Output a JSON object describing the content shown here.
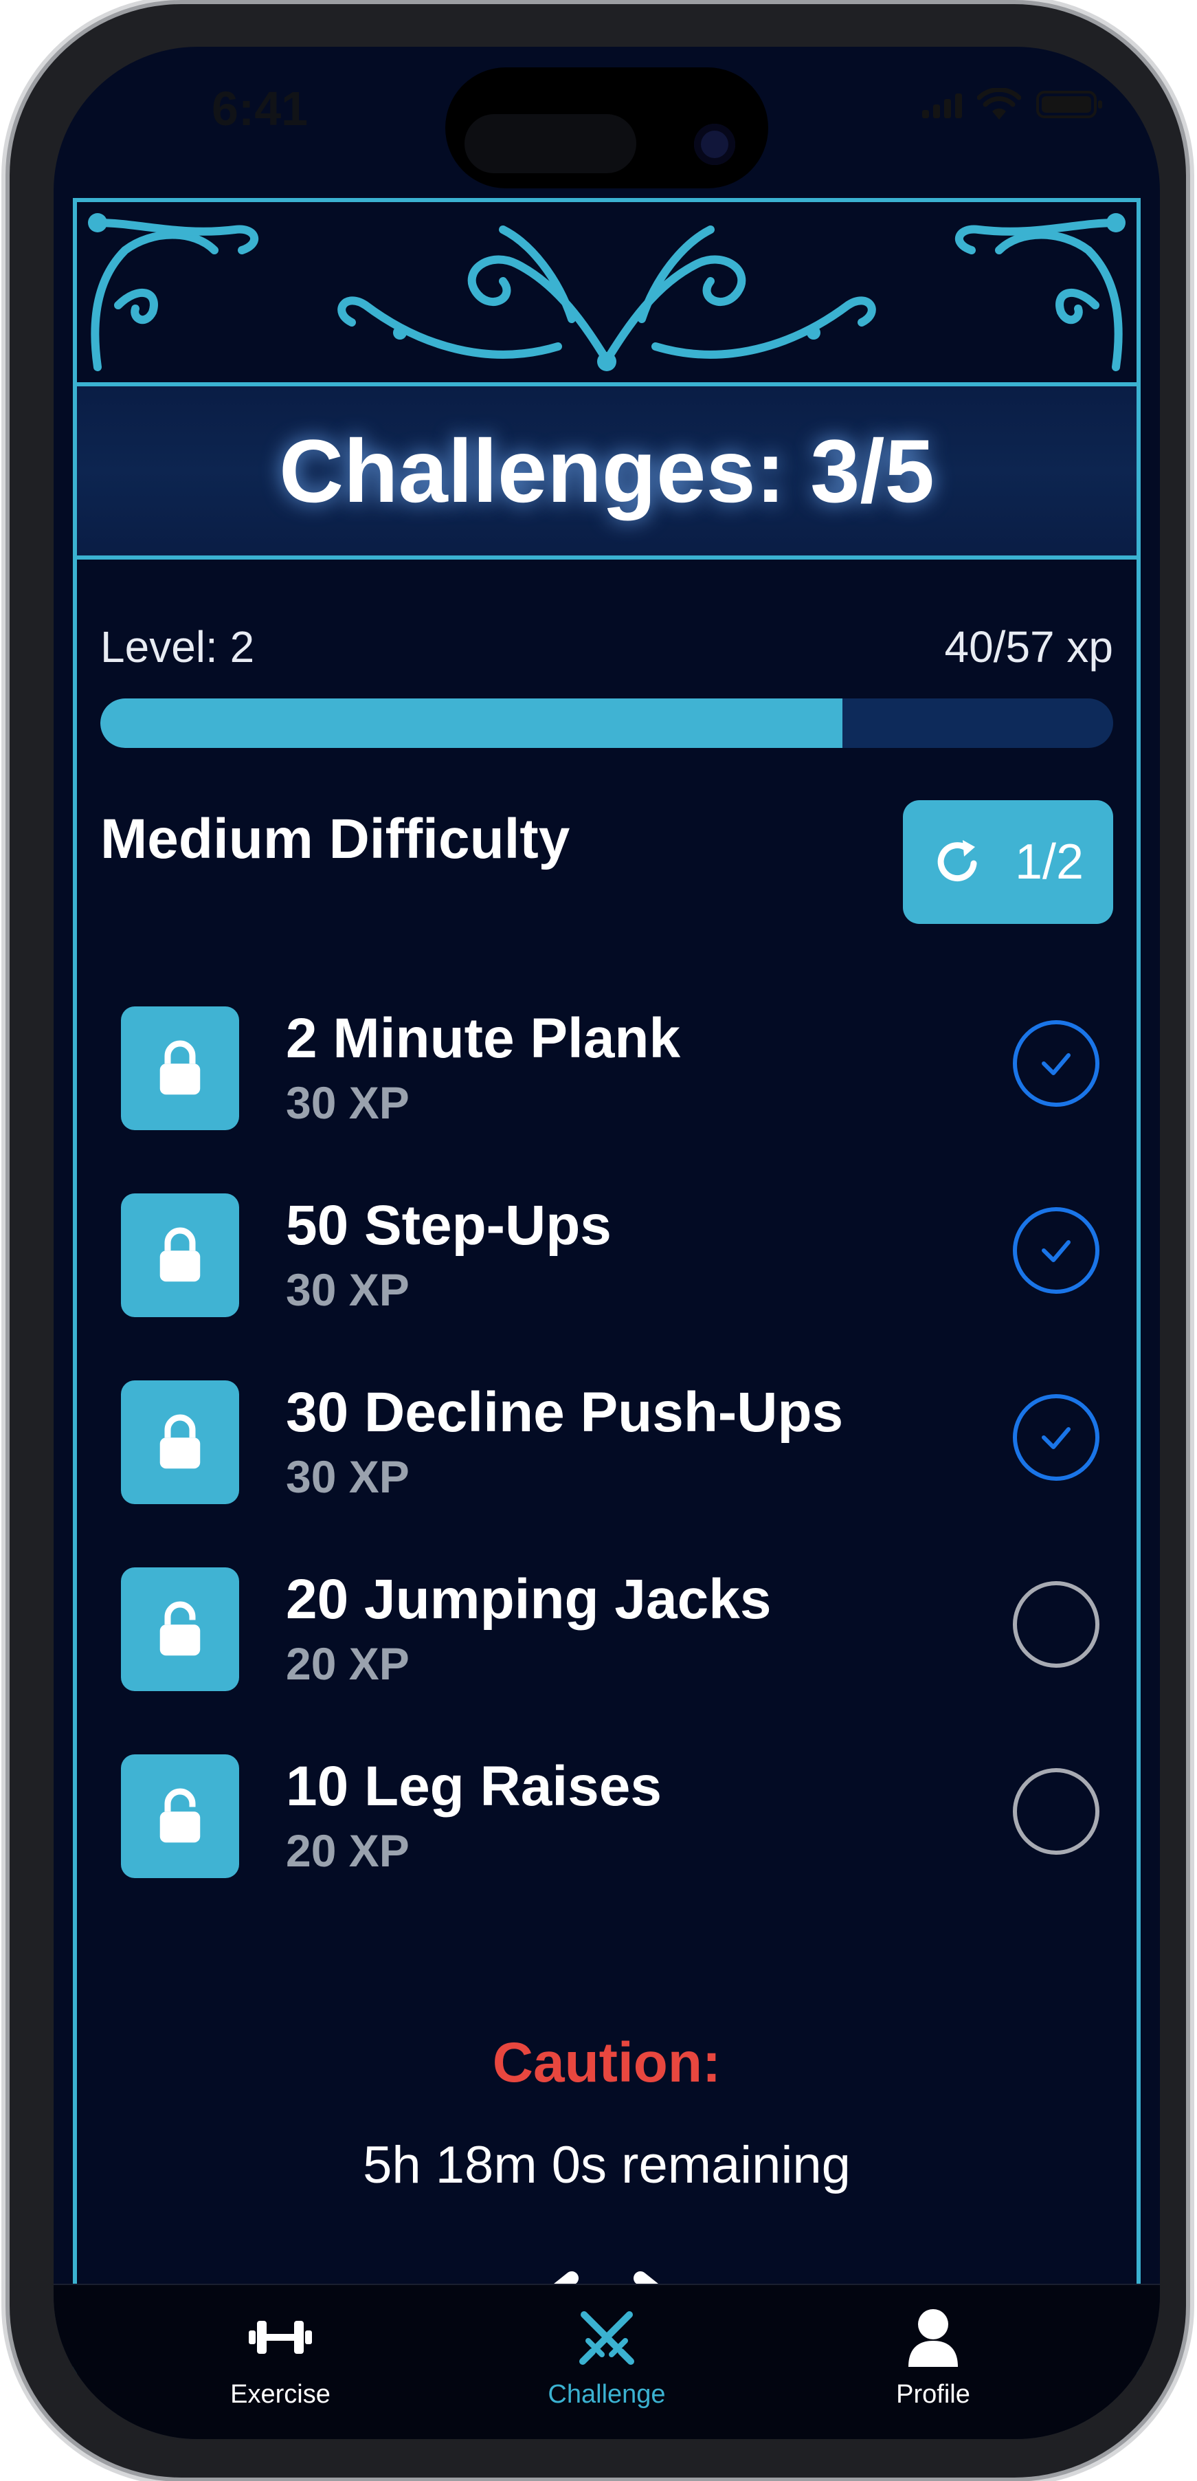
{
  "status_bar": {
    "time": "6:41"
  },
  "header": {
    "title": "Challenges: 3/5"
  },
  "progress": {
    "level_label": "Level: 2",
    "xp_label": "40/57 xp",
    "fraction": 0.733
  },
  "difficulty": {
    "label": "Medium Difficulty",
    "reroll_count": "1/2"
  },
  "challenges": [
    {
      "title": "2 Minute Plank",
      "xp": "30 XP",
      "completed": true
    },
    {
      "title": "50 Step-Ups",
      "xp": "30 XP",
      "completed": true
    },
    {
      "title": "30 Decline Push-Ups",
      "xp": "30 XP",
      "completed": true
    },
    {
      "title": "20 Jumping Jacks",
      "xp": "20 XP",
      "completed": false
    },
    {
      "title": "10 Leg Raises",
      "xp": "20 XP",
      "completed": false
    }
  ],
  "caution": {
    "label": "Caution:",
    "time_remaining": "5h 18m 0s remaining"
  },
  "tabs": [
    {
      "label": "Exercise",
      "icon": "dumbbell-icon",
      "active": false
    },
    {
      "label": "Challenge",
      "icon": "crossed-swords-icon",
      "active": true
    },
    {
      "label": "Profile",
      "icon": "person-icon",
      "active": false
    }
  ],
  "colors": {
    "accent": "#40b3d3",
    "background": "#030b24",
    "check_blue": "#1a75e8",
    "caution_red": "#e8473f"
  }
}
